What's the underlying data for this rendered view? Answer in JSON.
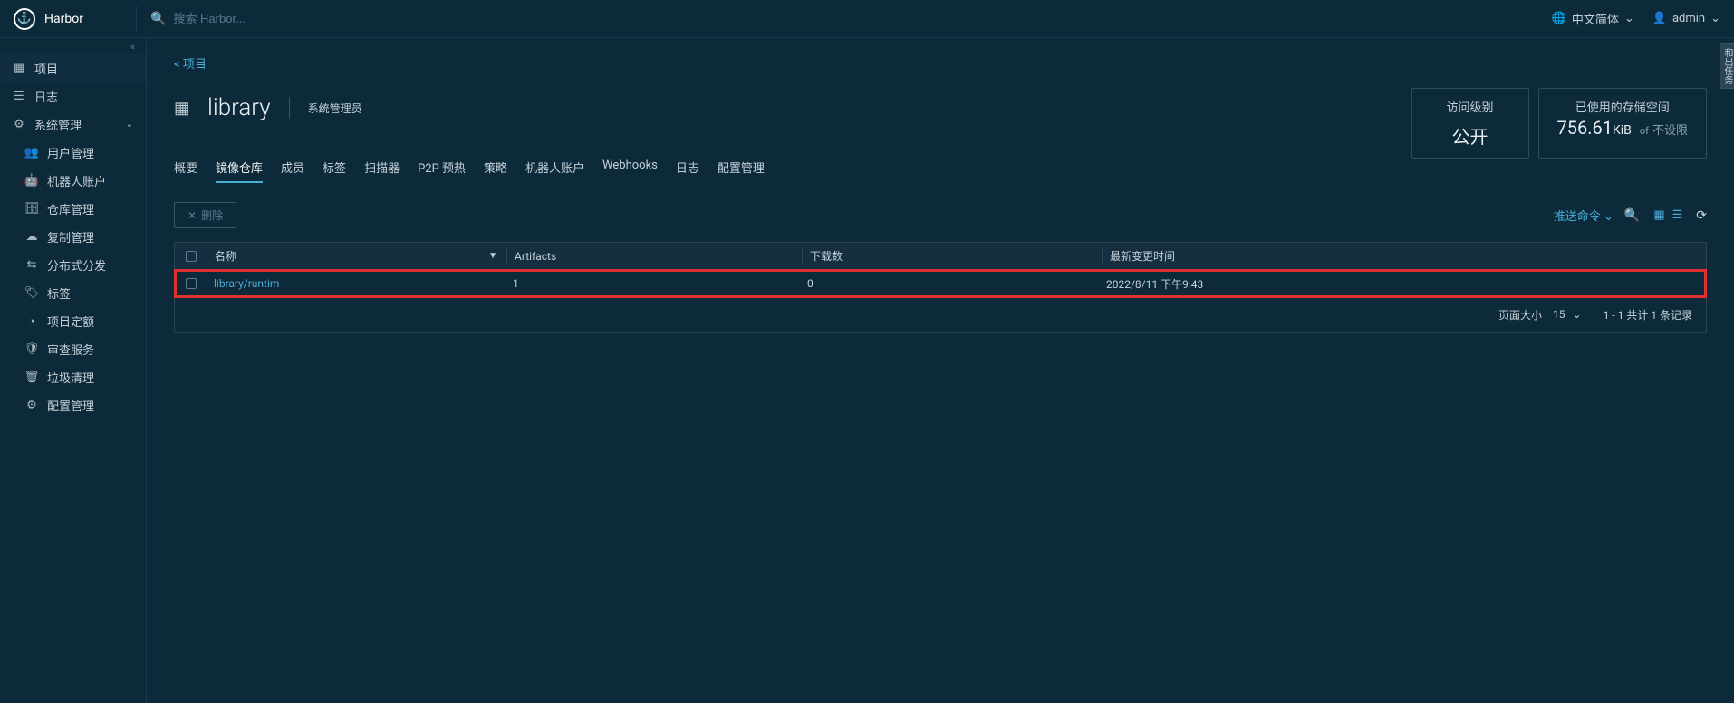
{
  "header": {
    "app_name": "Harbor",
    "search_placeholder": "搜索 Harbor...",
    "language": "中文简体",
    "user": "admin"
  },
  "sidebar": {
    "items": [
      {
        "icon": "grid",
        "label": "项目",
        "active": true
      },
      {
        "icon": "doc",
        "label": "日志"
      },
      {
        "icon": "gear",
        "label": "系统管理",
        "expandable": true
      }
    ],
    "sub_items": [
      {
        "icon": "users",
        "label": "用户管理"
      },
      {
        "icon": "robot",
        "label": "机器人账户"
      },
      {
        "icon": "db",
        "label": "仓库管理"
      },
      {
        "icon": "cloud",
        "label": "复制管理"
      },
      {
        "icon": "share",
        "label": "分布式分发"
      },
      {
        "icon": "tag",
        "label": "标签"
      },
      {
        "icon": "quota",
        "label": "项目定额"
      },
      {
        "icon": "shield",
        "label": "审查服务"
      },
      {
        "icon": "trash",
        "label": "垃圾清理"
      },
      {
        "icon": "cog",
        "label": "配置管理"
      }
    ]
  },
  "breadcrumb": {
    "back": "< 项目"
  },
  "project": {
    "name": "library",
    "role": "系统管理员"
  },
  "info_cards": {
    "access": {
      "label": "访问级别",
      "value": "公开"
    },
    "storage": {
      "label": "已使用的存储空间",
      "value": "756.61",
      "unit": "KiB",
      "of": "of",
      "limit": "不设限"
    }
  },
  "tabs": [
    {
      "label": "概要"
    },
    {
      "label": "镜像仓库",
      "active": true
    },
    {
      "label": "成员"
    },
    {
      "label": "标签"
    },
    {
      "label": "扫描器"
    },
    {
      "label": "P2P 预热"
    },
    {
      "label": "策略"
    },
    {
      "label": "机器人账户"
    },
    {
      "label": "Webhooks"
    },
    {
      "label": "日志"
    },
    {
      "label": "配置管理"
    }
  ],
  "toolbar": {
    "delete": "删除",
    "push_cmd": "推送命令"
  },
  "table": {
    "headers": {
      "name": "名称",
      "artifacts": "Artifacts",
      "downloads": "下载数",
      "time": "最新变更时间"
    },
    "rows": [
      {
        "name": "library/runtim",
        "artifacts": "1",
        "downloads": "0",
        "time": "2022/8/11 下午9:43"
      }
    ]
  },
  "pagination": {
    "page_size_label": "页面大小",
    "page_size": "15",
    "summary": "1 - 1 共计 1 条记录"
  },
  "side_tab": "和出任务"
}
